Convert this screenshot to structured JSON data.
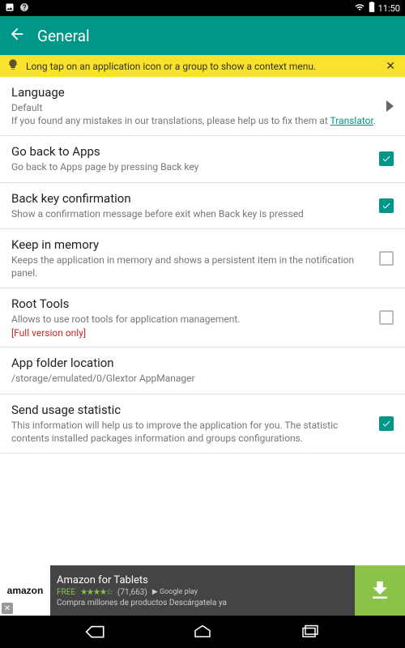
{
  "status": {
    "time": "11:50"
  },
  "appbar": {
    "title": "General"
  },
  "tip": {
    "text": "Long tap on an application icon or a group to show a context menu."
  },
  "items": {
    "language": {
      "title": "Language",
      "value": "Default",
      "help_pre": "If you found any mistakes in our translations, please help us to fix them at ",
      "link": "Translator",
      "help_post": "."
    },
    "goback": {
      "title": "Go back to Apps",
      "sub": "Go back to Apps page by pressing Back key",
      "checked": true
    },
    "backconfirm": {
      "title": "Back key confirmation",
      "sub": "Show a confirmation message before exit when Back key is pressed",
      "checked": true
    },
    "keepmem": {
      "title": "Keep in memory",
      "sub": "Keeps the application in memory and shows a persistent item in the notification panel.",
      "checked": false
    },
    "root": {
      "title": "Root Tools",
      "sub": "Allows to use root tools for application management.",
      "warn": "[Full version only]",
      "checked": false
    },
    "folder": {
      "title": "App folder location",
      "sub": "/storage/emulated/0/Glextor AppManager"
    },
    "usage": {
      "title": "Send usage statistic",
      "sub": "This information will help us to improve the application for you. The statistic contents installed packages information and groups configurations.",
      "checked": true
    }
  },
  "ad": {
    "brand": "amazon",
    "title": "Amazon for Tablets",
    "free": "FREE",
    "stars": "★★★★☆",
    "count": "(71,663)",
    "store": "▶ Google play",
    "desc": "Compra millones de productos Descárgatela ya"
  }
}
